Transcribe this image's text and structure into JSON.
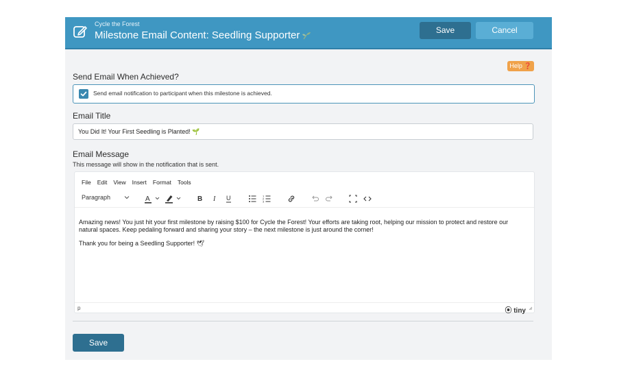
{
  "header": {
    "org": "Cycle the Forest",
    "title": "Milestone Email Content: Seedling Supporter",
    "save_label": "Save",
    "cancel_label": "Cancel"
  },
  "help": {
    "label": "Help ❓"
  },
  "send_email": {
    "label": "Send Email When Achieved?",
    "checkbox_text": "Send email notification to participant when this milestone is achieved.",
    "checked": true
  },
  "email_title": {
    "label": "Email Title",
    "value": "You Did It! Your First Seedling is Planted! 🌱"
  },
  "email_message": {
    "label": "Email Message",
    "sublabel": "This message will show in the notification that is sent.",
    "menu": [
      "File",
      "Edit",
      "View",
      "Insert",
      "Format",
      "Tools"
    ],
    "block_format": "Paragraph",
    "paragraphs": [
      "Amazing news! You just hit your first milestone by raising $100 for Cycle the Forest! Your efforts are taking root, helping our mission to protect and restore our natural spaces. Keep pedaling forward and sharing your story – the next milestone is just around the corner!",
      "Thank you for being a Seedling Supporter! 🕊"
    ],
    "status_path": "p",
    "brand": "tiny"
  },
  "footer": {
    "save_label": "Save"
  },
  "colors": {
    "header": "#3f97c2",
    "primary_button": "#2e6f90",
    "help": "#f0a24a"
  }
}
